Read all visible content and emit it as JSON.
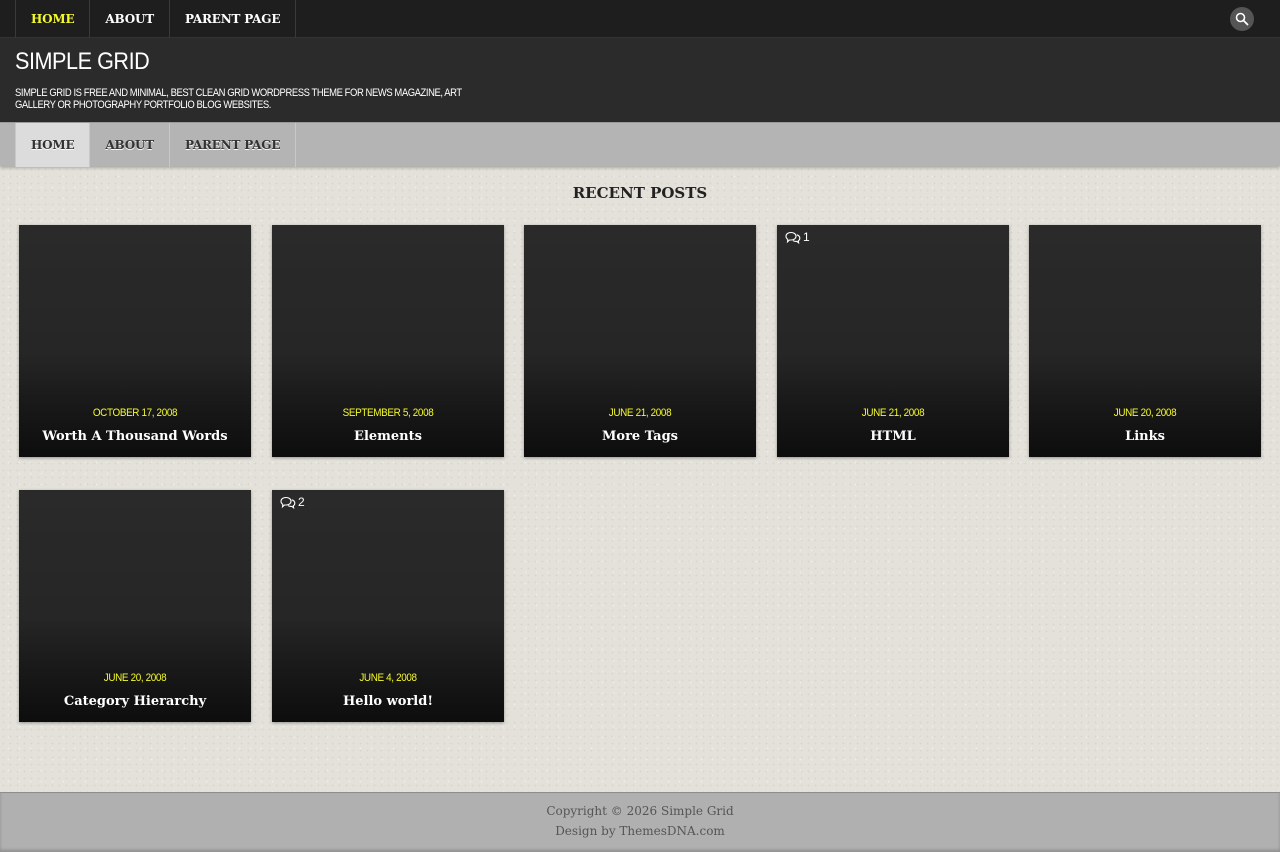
{
  "top_nav": {
    "items": [
      {
        "label": "HOME",
        "active": true
      },
      {
        "label": "ABOUT",
        "active": false
      },
      {
        "label": "PARENT PAGE",
        "active": false
      }
    ],
    "search_icon": "search-icon"
  },
  "header": {
    "site_title": "SIMPLE GRID",
    "site_description": "SIMPLE GRID IS FREE AND MINIMAL, BEST CLEAN GRID WORDPRESS THEME FOR NEWS MAGAZINE, ART GALLERY OR PHOTOGRAPHY PORTFOLIO BLOG WEBSITES."
  },
  "secondary_nav": {
    "items": [
      {
        "label": "HOME",
        "active": true
      },
      {
        "label": "ABOUT",
        "active": false
      },
      {
        "label": "PARENT PAGE",
        "active": false
      }
    ]
  },
  "main": {
    "section_title": "RECENT POSTS",
    "posts": [
      {
        "date": "OCTOBER 17, 2008",
        "title": "Worth A Thousand Words",
        "comments": ""
      },
      {
        "date": "SEPTEMBER 5, 2008",
        "title": "Elements",
        "comments": ""
      },
      {
        "date": "JUNE 21, 2008",
        "title": "More Tags",
        "comments": ""
      },
      {
        "date": "JUNE 21, 2008",
        "title": "HTML",
        "comments": "1"
      },
      {
        "date": "JUNE 20, 2008",
        "title": "Links",
        "comments": ""
      },
      {
        "date": "JUNE 20, 2008",
        "title": "Category Hierarchy",
        "comments": ""
      },
      {
        "date": "JUNE 4, 2008",
        "title": "Hello world!",
        "comments": "2"
      }
    ]
  },
  "footer": {
    "copyright": "Copyright © 2026 Simple Grid",
    "credit": "Design by ThemesDNA.com"
  },
  "colors": {
    "accent_yellow": "#f4f92c",
    "topbar_bg": "#1e1e1e",
    "header_bg": "#2b2b2b",
    "secnav_bg": "#b4b4b4",
    "footer_bg": "#b0b0b0"
  }
}
